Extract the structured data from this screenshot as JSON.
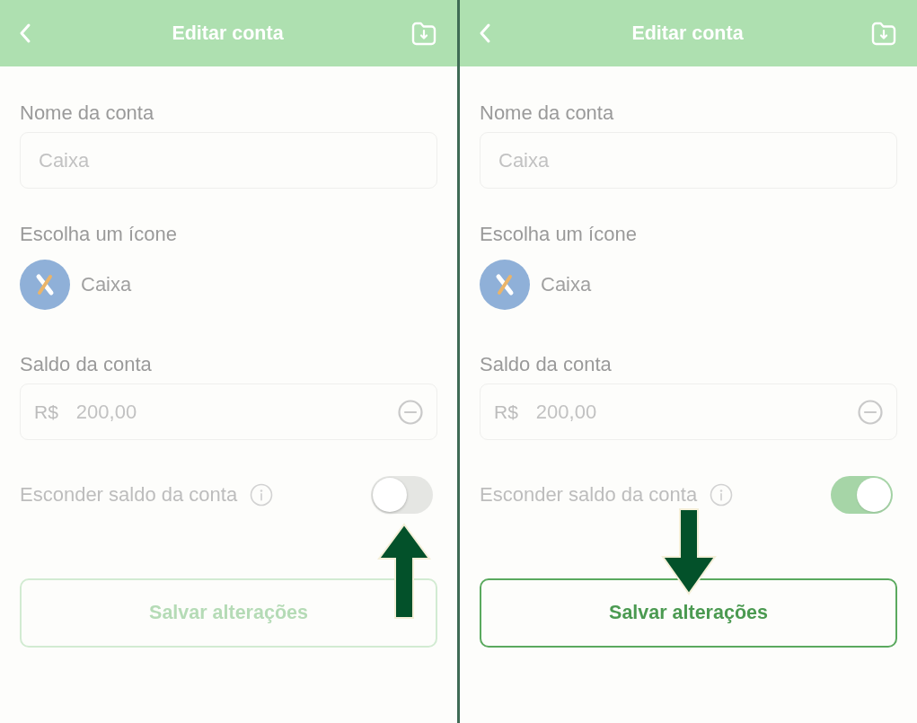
{
  "panels": [
    {
      "header": {
        "title": "Editar conta"
      },
      "account_name": {
        "label": "Nome da conta",
        "value": "Caixa"
      },
      "icon_picker": {
        "label": "Escolha um ícone",
        "selected_name": "Caixa"
      },
      "balance": {
        "label": "Saldo da conta",
        "currency": "R$",
        "value": "200,00"
      },
      "hide_balance": {
        "label": "Esconder saldo da conta",
        "on": false,
        "arrow_marker": true
      },
      "save_button": {
        "label": "Salvar alterações",
        "disabled": true,
        "arrow_marker": false
      }
    },
    {
      "header": {
        "title": "Editar conta"
      },
      "account_name": {
        "label": "Nome da conta",
        "value": "Caixa"
      },
      "icon_picker": {
        "label": "Escolha um ícone",
        "selected_name": "Caixa"
      },
      "balance": {
        "label": "Saldo da conta",
        "currency": "R$",
        "value": "200,00"
      },
      "hide_balance": {
        "label": "Esconder saldo da conta",
        "on": true,
        "arrow_marker": false
      },
      "save_button": {
        "label": "Salvar alterações",
        "disabled": false,
        "arrow_marker": true
      }
    }
  ]
}
